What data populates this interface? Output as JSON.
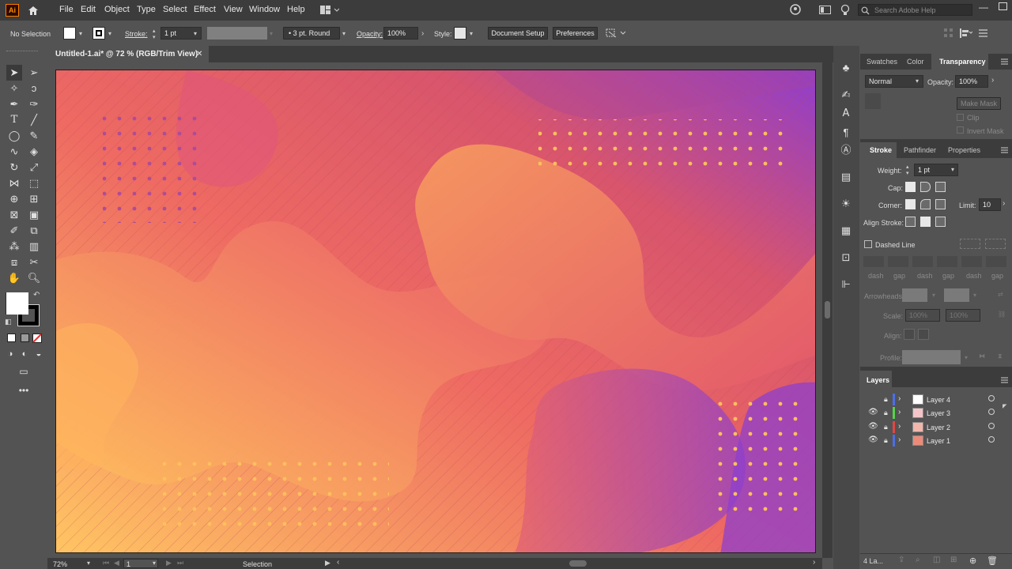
{
  "menubar": {
    "app_icon": "Ai",
    "items": [
      "File",
      "Edit",
      "Object",
      "Type",
      "Select",
      "Effect",
      "View",
      "Window",
      "Help"
    ],
    "search_placeholder": "Search Adobe Help"
  },
  "controlbar": {
    "selection_label": "No Selection",
    "stroke_label": "Stroke:",
    "stroke_weight": "1 pt",
    "brush_label": "3 pt. Round",
    "opacity_label": "Opacity:",
    "opacity_value": "100%",
    "style_label": "Style:",
    "document_setup": "Document Setup",
    "preferences": "Preferences"
  },
  "document": {
    "tab_title": "Untitled-1.ai* @ 72 % (RGB/Trim View)",
    "close": "✕"
  },
  "transparency_panel": {
    "tabs": [
      "Swatches",
      "Color",
      "Transparency"
    ],
    "active_tab": "Transparency",
    "blend_mode": "Normal",
    "opacity_label": "Opacity:",
    "opacity_value": "100%",
    "make_mask": "Make Mask",
    "clip": "Clip",
    "invert_mask": "Invert Mask"
  },
  "stroke_panel": {
    "tabs": [
      "Stroke",
      "Pathfinder",
      "Properties"
    ],
    "active_tab": "Stroke",
    "weight_label": "Weight:",
    "weight_value": "1 pt",
    "cap_label": "Cap:",
    "corner_label": "Corner:",
    "limit_label": "Limit:",
    "limit_value": "10",
    "align_label": "Align Stroke:",
    "dashed_line": "Dashed Line",
    "dash_gap_labels": [
      "dash",
      "gap",
      "dash",
      "gap",
      "dash",
      "gap"
    ],
    "arrowheads_label": "Arrowheads:",
    "scale_label": "Scale:",
    "scale_values": [
      "100%",
      "100%"
    ],
    "align_arrow_label": "Align:",
    "profile_label": "Profile:"
  },
  "layers_panel": {
    "title": "Layers",
    "layers": [
      {
        "name": "Layer 4",
        "color": "#4c6ee6",
        "visible": false
      },
      {
        "name": "Layer 3",
        "color": "#55d34b",
        "visible": true
      },
      {
        "name": "Layer 2",
        "color": "#e34646",
        "visible": true
      },
      {
        "name": "Layer 1",
        "color": "#4c6ee6",
        "visible": true
      }
    ],
    "footer_count": "4 La..."
  },
  "statusbar": {
    "zoom": "72%",
    "artboard_num": "1",
    "tool_name": "Selection"
  },
  "colors": {
    "chrome_dark": "#3c3c3c",
    "chrome_mid": "#535353",
    "accent": "#ff7c00"
  }
}
